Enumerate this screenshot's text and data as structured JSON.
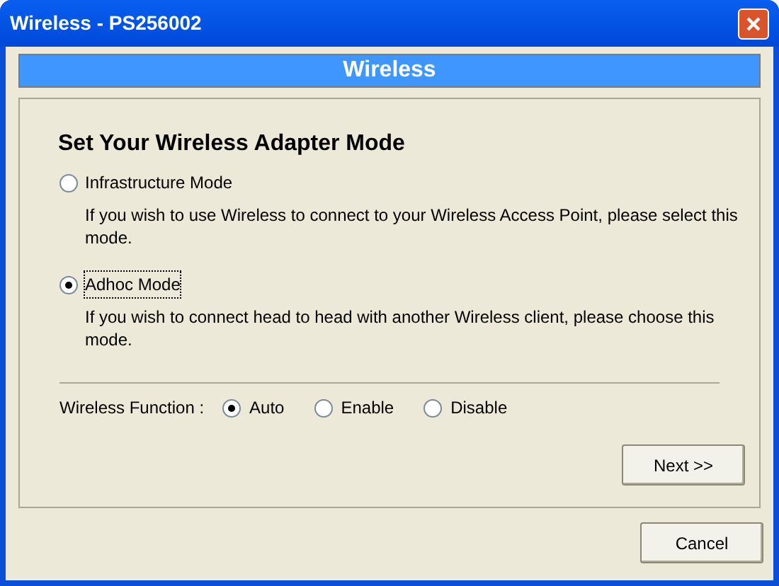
{
  "window": {
    "title": "Wireless - PS256002"
  },
  "header": "Wireless",
  "heading": "Set Your Wireless Adapter Mode",
  "modes": [
    {
      "label": "Infrastructure Mode",
      "description": "If you wish to use Wireless to connect to your Wireless Access Point, please select this mode.",
      "selected": false
    },
    {
      "label": "Adhoc Mode",
      "description": "If you wish to connect head to head with another Wireless client, please choose this mode.",
      "selected": true
    }
  ],
  "wireless_function": {
    "label": "Wireless Function :",
    "options": [
      {
        "label": "Auto",
        "selected": true
      },
      {
        "label": "Enable",
        "selected": false
      },
      {
        "label": "Disable",
        "selected": false
      }
    ]
  },
  "buttons": {
    "next": "Next >>",
    "cancel": "Cancel"
  }
}
